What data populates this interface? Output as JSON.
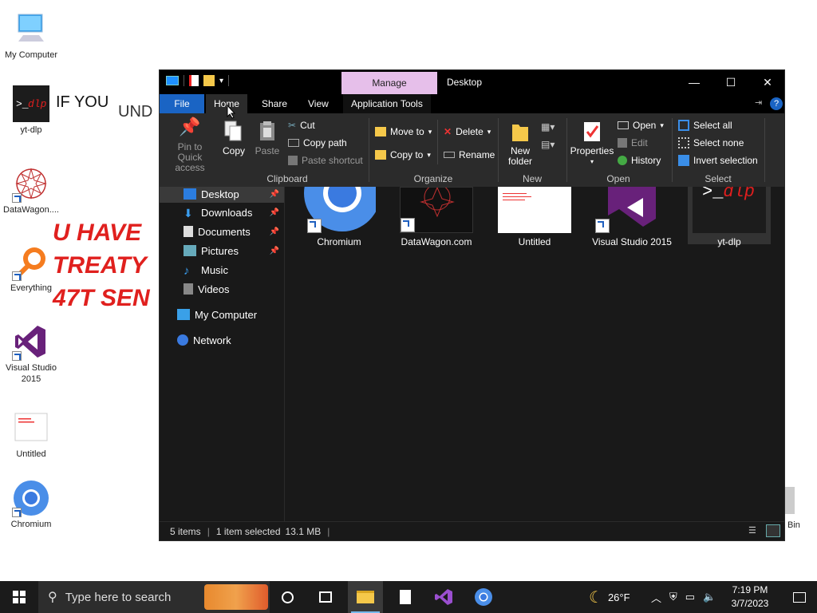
{
  "desktop": {
    "icons": [
      {
        "label": "My Computer"
      },
      {
        "label": "yt-dlp"
      },
      {
        "label": "DataWagon...."
      },
      {
        "label": "Everything"
      },
      {
        "label": "Visual Studio 2015"
      },
      {
        "label": "Untitled"
      },
      {
        "label": "Chromium"
      }
    ],
    "recycle_partial": "Bin",
    "wallpaper_lines": [
      "IF YOU",
      "UND",
      "U HAVE",
      "TREATY",
      "47T SEN"
    ]
  },
  "explorer": {
    "title": "Desktop",
    "manage_tab": "Manage",
    "tabs": {
      "file": "File",
      "home": "Home",
      "share": "Share",
      "view": "View",
      "app_tools": "Application Tools"
    },
    "ribbon": {
      "clipboard": {
        "label": "Clipboard",
        "pin": "Pin to Quick access",
        "copy": "Copy",
        "paste": "Paste",
        "cut": "Cut",
        "copy_path": "Copy path",
        "paste_shortcut": "Paste shortcut"
      },
      "organize": {
        "label": "Organize",
        "move_to": "Move to",
        "copy_to": "Copy to",
        "delete": "Delete",
        "rename": "Rename"
      },
      "new": {
        "label": "New",
        "new_folder": "New folder"
      },
      "open": {
        "label": "Open",
        "properties": "Properties",
        "open": "Open",
        "edit": "Edit",
        "history": "History"
      },
      "select": {
        "label": "Select",
        "select_all": "Select all",
        "select_none": "Select none",
        "invert": "Invert selection"
      }
    },
    "nav": [
      {
        "label": "Desktop",
        "pinned": true
      },
      {
        "label": "Downloads",
        "pinned": true
      },
      {
        "label": "Documents",
        "pinned": true
      },
      {
        "label": "Pictures",
        "pinned": true
      },
      {
        "label": "Music",
        "pinned": false
      },
      {
        "label": "Videos",
        "pinned": false
      },
      {
        "label": "My Computer",
        "pinned": false
      },
      {
        "label": "Network",
        "pinned": false
      }
    ],
    "files": [
      {
        "name": "Chromium"
      },
      {
        "name": "DataWagon.com"
      },
      {
        "name": "Untitled"
      },
      {
        "name": "Visual Studio 2015"
      },
      {
        "name": "yt-dlp",
        "thumb_text": ">_dlp"
      }
    ],
    "status": {
      "items": "5 items",
      "selected": "1 item selected",
      "size": "13.1 MB"
    }
  },
  "taskbar": {
    "search_placeholder": "Type here to search",
    "weather": "26°F",
    "time": "7:19 PM",
    "date": "3/7/2023"
  },
  "colors": {
    "accent": "#1a64c4",
    "manage": "#e6bfea",
    "ytdlp_red": "#e01e1e"
  }
}
